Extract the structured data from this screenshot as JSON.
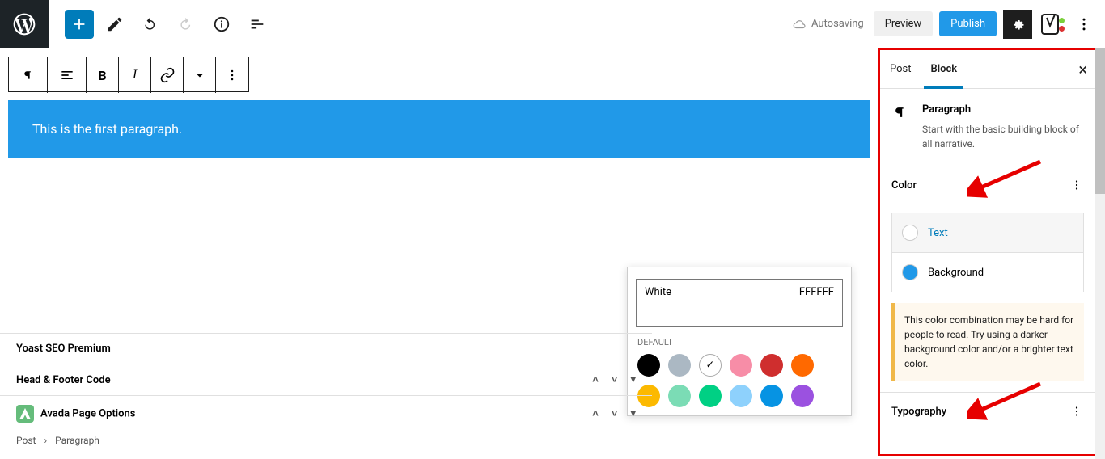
{
  "toolbar": {
    "autosave": "Autosaving",
    "preview": "Preview",
    "publish": "Publish"
  },
  "paragraph_text": "This is the first paragraph.",
  "color_popover": {
    "color_name": "White",
    "color_hex": "FFFFFF",
    "default_label": "DEFAULT",
    "swatches": [
      "#000000",
      "#abb8c3",
      "#ffffff",
      "#f78da7",
      "#cf2e2e",
      "#ff6900",
      "#fcb900",
      "#7bdcb5",
      "#00d084",
      "#8ed1fc",
      "#0693e3",
      "#9b51e0"
    ],
    "selected_index": 2
  },
  "meta_panels": {
    "yoast": "Yoast SEO Premium",
    "hf": "Head & Footer Code",
    "avada": "Avada Page Options"
  },
  "breadcrumb": {
    "root": "Post",
    "leaf": "Paragraph"
  },
  "sidebar": {
    "tab_post": "Post",
    "tab_block": "Block",
    "block_title": "Paragraph",
    "block_desc": "Start with the basic building block of all narrative.",
    "section_color": "Color",
    "text_label": "Text",
    "bg_label": "Background",
    "bg_color": "#2199e8",
    "warning": "This color combination may be hard for people to read. Try using a darker background color and/or a brighter text color.",
    "section_typo": "Typography"
  }
}
